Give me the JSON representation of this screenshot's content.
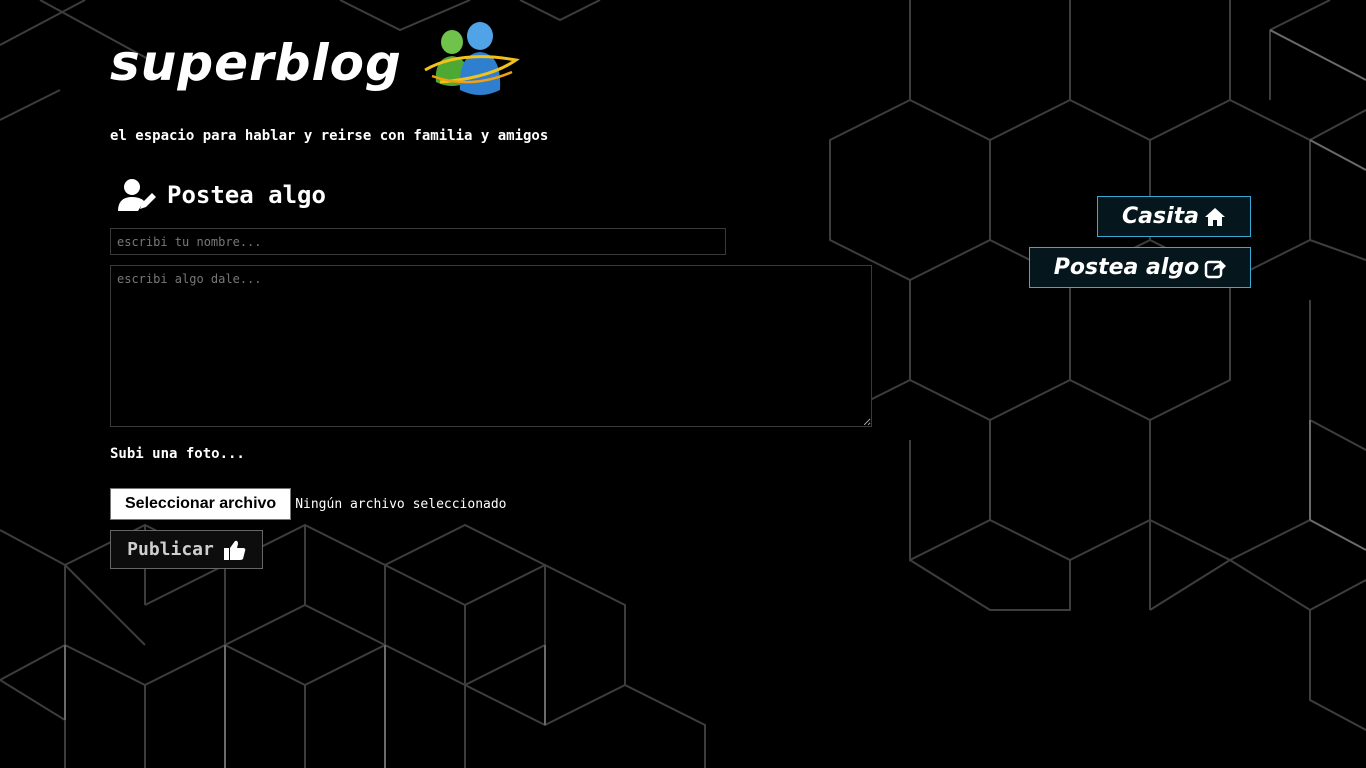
{
  "brand": {
    "logo_text": "superblog",
    "logo_icon": "messenger-buddies-icon",
    "tagline": "el espacio para hablar y reirse con familia y amigos"
  },
  "form": {
    "title": "Postea algo",
    "title_icon": "user-edit-icon",
    "name_placeholder": "escribi tu nombre...",
    "body_placeholder": "escribi algo dale...",
    "photo_label": "Subi una foto...",
    "file_button_label": "Seleccionar archivo",
    "file_status": "Ningún archivo seleccionado",
    "publish_label": "Publicar",
    "publish_icon": "thumbs-up-icon"
  },
  "nav": {
    "home_label": "Casita",
    "home_icon": "home-icon",
    "post_label": "Postea algo",
    "post_icon": "share-square-icon"
  },
  "colors": {
    "background": "#000000",
    "accent_border": "#38a9d4",
    "text": "#ffffff"
  }
}
